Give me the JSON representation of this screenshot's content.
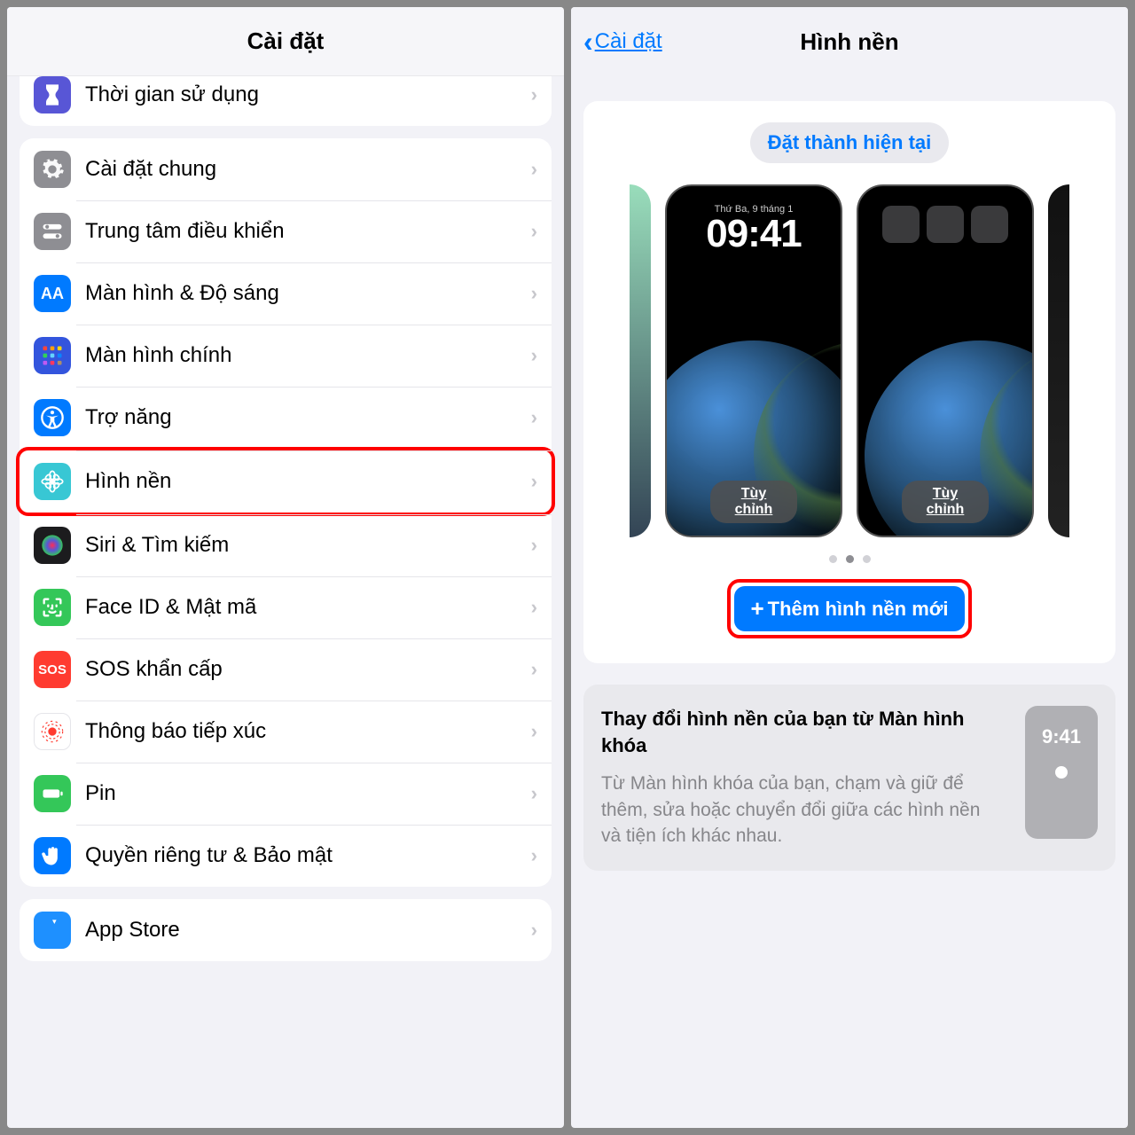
{
  "left": {
    "title": "Cài đặt",
    "partial": "Thời gian sử dụng",
    "items": [
      {
        "label": "Cài đặt chung",
        "icon": "gear",
        "bg": "#8e8e93"
      },
      {
        "label": "Trung tâm điều khiển",
        "icon": "switches",
        "bg": "#8e8e93"
      },
      {
        "label": "Màn hình & Độ sáng",
        "icon": "aa",
        "bg": "#007aff"
      },
      {
        "label": "Màn hình chính",
        "icon": "grid",
        "bg": "#3355dd"
      },
      {
        "label": "Trợ năng",
        "icon": "accessibility",
        "bg": "#007aff"
      },
      {
        "label": "Hình nền",
        "icon": "flower",
        "bg": "#38c7d4",
        "highlight": true
      },
      {
        "label": "Siri & Tìm kiếm",
        "icon": "siri",
        "bg": "#1c1c1e"
      },
      {
        "label": "Face ID & Mật mã",
        "icon": "faceid",
        "bg": "#34c759"
      },
      {
        "label": "SOS khẩn cấp",
        "icon": "sos",
        "bg": "#ff3b30"
      },
      {
        "label": "Thông báo tiếp xúc",
        "icon": "exposure",
        "bg": "#fff",
        "border": true
      },
      {
        "label": "Pin",
        "icon": "battery",
        "bg": "#34c759"
      },
      {
        "label": "Quyền riêng tư & Bảo mật",
        "icon": "hand",
        "bg": "#007aff"
      }
    ],
    "appstore": "App Store"
  },
  "right": {
    "back": "Cài đặt",
    "title": "Hình nền",
    "setCurrent": "Đặt thành hiện tại",
    "lockDate": "Thứ Ba, 9 tháng 1",
    "lockTime": "09:41",
    "customize": "Tùy chỉnh",
    "addNew": "Thêm hình nền mới",
    "infoTitle": "Thay đổi hình nền của bạn từ Màn hình khóa",
    "infoDesc": "Từ Màn hình khóa của bạn, chạm và giữ để thêm, sửa hoặc chuyển đổi giữa các hình nền và tiện ích khác nhau.",
    "infoTime": "9:41"
  }
}
